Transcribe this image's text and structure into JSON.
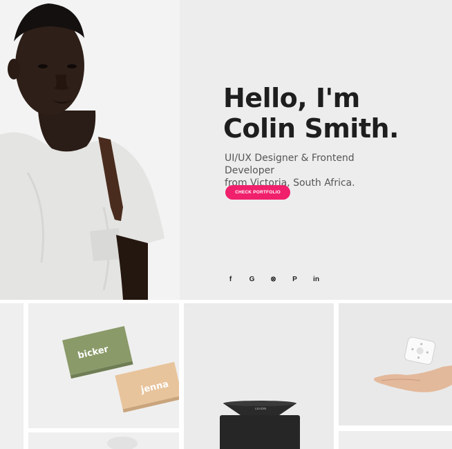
{
  "hero": {
    "title_line1": "Hello, I'm",
    "title_line2": "Colin Smith.",
    "subtitle_line1": "UI/UX Designer & Frontend Developer",
    "subtitle_line2": "from Victoria, South Africa.",
    "cta_label": "CHECK PORTFOLIO",
    "cta_color": "#f0206c",
    "photo_icon": "portrait-photo"
  },
  "social": [
    {
      "glyph": "f",
      "icon": "facebook-icon"
    },
    {
      "glyph": "G",
      "icon": "google-icon"
    },
    {
      "glyph": "⊗",
      "icon": "dribbble-icon"
    },
    {
      "glyph": "P",
      "icon": "pinterest-icon"
    },
    {
      "glyph": "in",
      "icon": "linkedin-icon"
    }
  ],
  "portfolio": {
    "card_top_text": "bicker",
    "card_bottom_text": "jenna",
    "product_label": "LEADIN"
  }
}
